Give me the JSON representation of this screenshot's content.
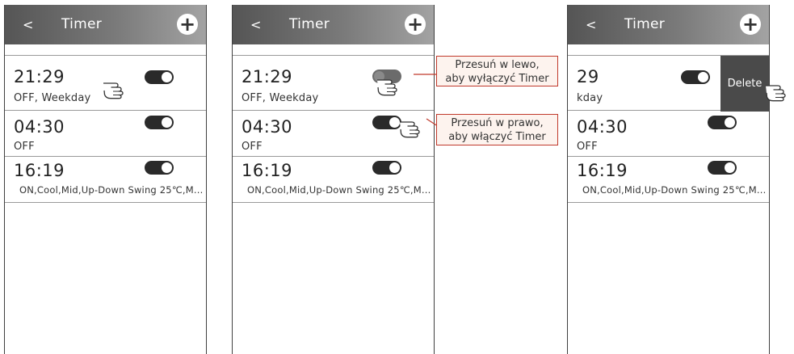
{
  "header": {
    "back": "<",
    "title": "Timer",
    "add": "+"
  },
  "panel1": {
    "rows": [
      {
        "time": "21:29",
        "sub": "OFF, Weekday"
      },
      {
        "time": "04:30",
        "sub": "OFF"
      },
      {
        "time": "16:19",
        "sub": "ON,Cool,Mid,Up-Down Swing 25℃,M..."
      }
    ]
  },
  "panel2": {
    "rows": [
      {
        "time": "21:29",
        "sub": "OFF, Weekday"
      },
      {
        "time": "04:30",
        "sub": "OFF"
      },
      {
        "time": "16:19",
        "sub": "ON,Cool,Mid,Up-Down Swing 25℃,M..."
      }
    ],
    "callout_left": {
      "line1": "Przesuń w lewo,",
      "line2": "aby wyłączyć Timer"
    },
    "callout_right": {
      "line1": "Przesuń w prawo,",
      "line2": "aby włączyć Timer"
    }
  },
  "panel3": {
    "rows": [
      {
        "time": "29",
        "sub": "kday"
      },
      {
        "time": "04:30",
        "sub": "OFF"
      },
      {
        "time": "16:19",
        "sub": "ON,Cool,Mid,Up-Down Swing 25℃,M..."
      }
    ],
    "delete": "Delete"
  },
  "colors": {
    "header_dark": "#555555",
    "header_light": "#a3a3a3",
    "callout_border": "#c0392b",
    "toggle_on": "#2a2a2a",
    "delete_bg": "#4a4a4a"
  },
  "icons": [
    "back-icon",
    "plus-icon",
    "toggle-switch",
    "hand-pointer-icon"
  ]
}
